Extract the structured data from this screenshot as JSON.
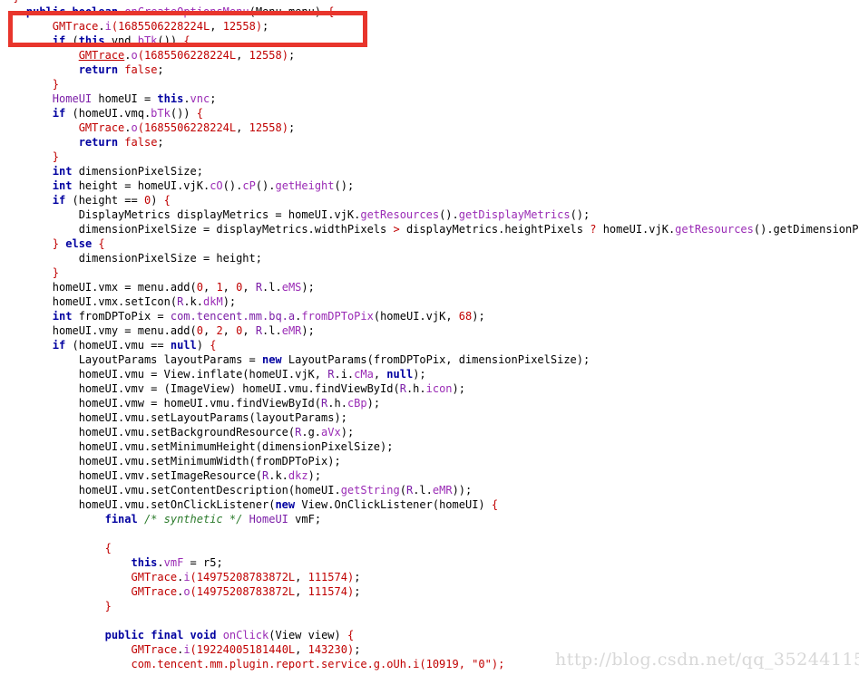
{
  "code_lines": [
    [
      {
        "t": "  }",
        "c": "p"
      }
    ],
    [
      {
        "t": "    "
      },
      {
        "t": "public",
        "c": "kw"
      },
      {
        "t": " "
      },
      {
        "t": "boolean",
        "c": "kw"
      },
      {
        "t": " "
      },
      {
        "t": "onCreateOptionsMenu",
        "c": "mt"
      },
      {
        "t": "(Menu menu) "
      },
      {
        "t": "{",
        "c": "p"
      }
    ],
    [
      {
        "t": "        "
      },
      {
        "t": "GMTrace",
        "c": "nm"
      },
      {
        "t": "."
      },
      {
        "t": "i",
        "c": "mt"
      },
      {
        "t": "(",
        "c": "p"
      },
      {
        "t": "1685506228224L",
        "c": "nm"
      },
      {
        "t": ", "
      },
      {
        "t": "12558",
        "c": "nm"
      },
      {
        "t": ")",
        "c": "p"
      },
      {
        "t": ";"
      }
    ],
    [
      {
        "t": "        "
      },
      {
        "t": "if",
        "c": "kw"
      },
      {
        "t": " ("
      },
      {
        "t": "this",
        "c": "kw"
      },
      {
        "t": ".vnd."
      },
      {
        "t": "bTk",
        "c": "mt"
      },
      {
        "t": "()) "
      },
      {
        "t": "{",
        "c": "p"
      }
    ],
    [
      {
        "t": "            "
      },
      {
        "t": "GMTrace",
        "c": "nm ul"
      },
      {
        "t": "."
      },
      {
        "t": "o",
        "c": "mt"
      },
      {
        "t": "(",
        "c": "p"
      },
      {
        "t": "1685506228224L",
        "c": "nm"
      },
      {
        "t": ", "
      },
      {
        "t": "12558",
        "c": "nm"
      },
      {
        "t": ")",
        "c": "p"
      },
      {
        "t": ";"
      }
    ],
    [
      {
        "t": "            "
      },
      {
        "t": "return",
        "c": "kw"
      },
      {
        "t": " "
      },
      {
        "t": "false",
        "c": "nm"
      },
      {
        "t": ";"
      }
    ],
    [
      {
        "t": "        "
      },
      {
        "t": "}",
        "c": "p"
      }
    ],
    [
      {
        "t": "        "
      },
      {
        "t": "HomeUI",
        "c": "ty"
      },
      {
        "t": " homeUI = "
      },
      {
        "t": "this",
        "c": "kw"
      },
      {
        "t": "."
      },
      {
        "t": "vnc",
        "c": "mt"
      },
      {
        "t": ";"
      }
    ],
    [
      {
        "t": "        "
      },
      {
        "t": "if",
        "c": "kw"
      },
      {
        "t": " (homeUI.vmq."
      },
      {
        "t": "bTk",
        "c": "mt"
      },
      {
        "t": "()) "
      },
      {
        "t": "{",
        "c": "p"
      }
    ],
    [
      {
        "t": "            "
      },
      {
        "t": "GMTrace",
        "c": "nm"
      },
      {
        "t": "."
      },
      {
        "t": "o",
        "c": "mt"
      },
      {
        "t": "(",
        "c": "p"
      },
      {
        "t": "1685506228224L",
        "c": "nm"
      },
      {
        "t": ", "
      },
      {
        "t": "12558",
        "c": "nm"
      },
      {
        "t": ")",
        "c": "p"
      },
      {
        "t": ";"
      }
    ],
    [
      {
        "t": "            "
      },
      {
        "t": "return",
        "c": "kw"
      },
      {
        "t": " "
      },
      {
        "t": "false",
        "c": "nm"
      },
      {
        "t": ";"
      }
    ],
    [
      {
        "t": "        "
      },
      {
        "t": "}",
        "c": "p"
      }
    ],
    [
      {
        "t": "        "
      },
      {
        "t": "int",
        "c": "kw"
      },
      {
        "t": " dimensionPixelSize;"
      }
    ],
    [
      {
        "t": "        "
      },
      {
        "t": "int",
        "c": "kw"
      },
      {
        "t": " height = homeUI.vjK."
      },
      {
        "t": "cO",
        "c": "mt"
      },
      {
        "t": "()."
      },
      {
        "t": "cP",
        "c": "mt"
      },
      {
        "t": "()."
      },
      {
        "t": "getHeight",
        "c": "mt"
      },
      {
        "t": "();"
      }
    ],
    [
      {
        "t": "        "
      },
      {
        "t": "if",
        "c": "kw"
      },
      {
        "t": " (height == "
      },
      {
        "t": "0",
        "c": "nm"
      },
      {
        "t": ") "
      },
      {
        "t": "{",
        "c": "p"
      }
    ],
    [
      {
        "t": "            DisplayMetrics displayMetrics = homeUI.vjK."
      },
      {
        "t": "getResources",
        "c": "mt"
      },
      {
        "t": "()."
      },
      {
        "t": "getDisplayMetrics",
        "c": "mt"
      },
      {
        "t": "();"
      }
    ],
    [
      {
        "t": "            dimensionPixelSize = displayMetrics.widthPixels "
      },
      {
        "t": ">",
        "c": "p"
      },
      {
        "t": " displayMetrics.heightPixels "
      },
      {
        "t": "?",
        "c": "p"
      },
      {
        "t": " homeUI.vjK."
      },
      {
        "t": "getResources",
        "c": "mt"
      },
      {
        "t": "().getDimensionPixelSize("
      }
    ],
    [
      {
        "t": "        "
      },
      {
        "t": "}",
        "c": "p"
      },
      {
        "t": " "
      },
      {
        "t": "else",
        "c": "kw"
      },
      {
        "t": " "
      },
      {
        "t": "{",
        "c": "p"
      }
    ],
    [
      {
        "t": "            dimensionPixelSize = height;"
      }
    ],
    [
      {
        "t": "        "
      },
      {
        "t": "}",
        "c": "p"
      }
    ],
    [
      {
        "t": "        homeUI.vmx = menu.add("
      },
      {
        "t": "0",
        "c": "nm"
      },
      {
        "t": ", "
      },
      {
        "t": "1",
        "c": "nm"
      },
      {
        "t": ", "
      },
      {
        "t": "0",
        "c": "nm"
      },
      {
        "t": ", "
      },
      {
        "t": "R",
        "c": "ty"
      },
      {
        "t": ".l."
      },
      {
        "t": "eMS",
        "c": "mt"
      },
      {
        "t": ");"
      }
    ],
    [
      {
        "t": "        homeUI.vmx.setIcon("
      },
      {
        "t": "R",
        "c": "ty"
      },
      {
        "t": ".k."
      },
      {
        "t": "dkM",
        "c": "mt"
      },
      {
        "t": ");"
      }
    ],
    [
      {
        "t": "        "
      },
      {
        "t": "int",
        "c": "kw"
      },
      {
        "t": " fromDPToPix = "
      },
      {
        "t": "com.tencent.mm.bq.a",
        "c": "ty"
      },
      {
        "t": "."
      },
      {
        "t": "fromDPToPix",
        "c": "mt"
      },
      {
        "t": "(homeUI.vjK, "
      },
      {
        "t": "68",
        "c": "nm"
      },
      {
        "t": ");"
      }
    ],
    [
      {
        "t": "        homeUI.vmy = menu.add("
      },
      {
        "t": "0",
        "c": "nm"
      },
      {
        "t": ", "
      },
      {
        "t": "2",
        "c": "nm"
      },
      {
        "t": ", "
      },
      {
        "t": "0",
        "c": "nm"
      },
      {
        "t": ", "
      },
      {
        "t": "R",
        "c": "ty"
      },
      {
        "t": ".l."
      },
      {
        "t": "eMR",
        "c": "mt"
      },
      {
        "t": ");"
      }
    ],
    [
      {
        "t": "        "
      },
      {
        "t": "if",
        "c": "kw"
      },
      {
        "t": " (homeUI.vmu == "
      },
      {
        "t": "null",
        "c": "kw"
      },
      {
        "t": ") "
      },
      {
        "t": "{",
        "c": "p"
      }
    ],
    [
      {
        "t": "            LayoutParams layoutParams = "
      },
      {
        "t": "new",
        "c": "kw"
      },
      {
        "t": " LayoutParams(fromDPToPix, dimensionPixelSize);"
      }
    ],
    [
      {
        "t": "            homeUI.vmu = View.inflate(homeUI.vjK, "
      },
      {
        "t": "R",
        "c": "ty"
      },
      {
        "t": ".i."
      },
      {
        "t": "cMa",
        "c": "mt"
      },
      {
        "t": ", "
      },
      {
        "t": "null",
        "c": "kw"
      },
      {
        "t": ");"
      }
    ],
    [
      {
        "t": "            homeUI.vmv = (ImageView) homeUI.vmu.findViewById("
      },
      {
        "t": "R",
        "c": "ty"
      },
      {
        "t": ".h."
      },
      {
        "t": "icon",
        "c": "mt"
      },
      {
        "t": ");"
      }
    ],
    [
      {
        "t": "            homeUI.vmw = homeUI.vmu.findViewById("
      },
      {
        "t": "R",
        "c": "ty"
      },
      {
        "t": ".h."
      },
      {
        "t": "cBp",
        "c": "mt"
      },
      {
        "t": ");"
      }
    ],
    [
      {
        "t": "            homeUI.vmu.setLayoutParams(layoutParams);"
      }
    ],
    [
      {
        "t": "            homeUI.vmu.setBackgroundResource("
      },
      {
        "t": "R",
        "c": "ty"
      },
      {
        "t": ".g."
      },
      {
        "t": "aVx",
        "c": "mt"
      },
      {
        "t": ");"
      }
    ],
    [
      {
        "t": "            homeUI.vmu.setMinimumHeight(dimensionPixelSize);"
      }
    ],
    [
      {
        "t": "            homeUI.vmu.setMinimumWidth(fromDPToPix);"
      }
    ],
    [
      {
        "t": "            homeUI.vmv.setImageResource("
      },
      {
        "t": "R",
        "c": "ty"
      },
      {
        "t": ".k."
      },
      {
        "t": "dkz",
        "c": "mt"
      },
      {
        "t": ");"
      }
    ],
    [
      {
        "t": "            homeUI.vmu.setContentDescription(homeUI."
      },
      {
        "t": "getString",
        "c": "mt"
      },
      {
        "t": "("
      },
      {
        "t": "R",
        "c": "ty"
      },
      {
        "t": ".l."
      },
      {
        "t": "eMR",
        "c": "mt"
      },
      {
        "t": "));"
      }
    ],
    [
      {
        "t": "            homeUI.vmu.setOnClickListener("
      },
      {
        "t": "new",
        "c": "kw"
      },
      {
        "t": " View.OnClickListener(homeUI) "
      },
      {
        "t": "{",
        "c": "p"
      }
    ],
    [
      {
        "t": "                "
      },
      {
        "t": "final",
        "c": "kw"
      },
      {
        "t": " "
      },
      {
        "t": "/* synthetic */",
        "c": "cm"
      },
      {
        "t": " "
      },
      {
        "t": "HomeUI",
        "c": "ty"
      },
      {
        "t": " vmF;"
      }
    ],
    [
      {
        "t": ""
      }
    ],
    [
      {
        "t": "                "
      },
      {
        "t": "{",
        "c": "p"
      }
    ],
    [
      {
        "t": "                    "
      },
      {
        "t": "this",
        "c": "kw"
      },
      {
        "t": "."
      },
      {
        "t": "vmF",
        "c": "mt"
      },
      {
        "t": " = r5;"
      }
    ],
    [
      {
        "t": "                    "
      },
      {
        "t": "GMTrace",
        "c": "nm"
      },
      {
        "t": "."
      },
      {
        "t": "i",
        "c": "mt"
      },
      {
        "t": "(",
        "c": "p"
      },
      {
        "t": "14975208783872L",
        "c": "nm"
      },
      {
        "t": ", "
      },
      {
        "t": "111574",
        "c": "nm"
      },
      {
        "t": ")",
        "c": "p"
      },
      {
        "t": ";"
      }
    ],
    [
      {
        "t": "                    "
      },
      {
        "t": "GMTrace",
        "c": "nm"
      },
      {
        "t": "."
      },
      {
        "t": "o",
        "c": "mt"
      },
      {
        "t": "(",
        "c": "p"
      },
      {
        "t": "14975208783872L",
        "c": "nm"
      },
      {
        "t": ", "
      },
      {
        "t": "111574",
        "c": "nm"
      },
      {
        "t": ")",
        "c": "p"
      },
      {
        "t": ";"
      }
    ],
    [
      {
        "t": "                "
      },
      {
        "t": "}",
        "c": "p"
      }
    ],
    [
      {
        "t": ""
      }
    ],
    [
      {
        "t": "                "
      },
      {
        "t": "public",
        "c": "kw"
      },
      {
        "t": " "
      },
      {
        "t": "final",
        "c": "kw"
      },
      {
        "t": " "
      },
      {
        "t": "void",
        "c": "kw"
      },
      {
        "t": " "
      },
      {
        "t": "onClick",
        "c": "mt"
      },
      {
        "t": "(View view) "
      },
      {
        "t": "{",
        "c": "p"
      }
    ],
    [
      {
        "t": "                    "
      },
      {
        "t": "GMTrace",
        "c": "nm"
      },
      {
        "t": "."
      },
      {
        "t": "i",
        "c": "mt"
      },
      {
        "t": "(",
        "c": "p"
      },
      {
        "t": "19224005181440L",
        "c": "nm"
      },
      {
        "t": ", "
      },
      {
        "t": "143230",
        "c": "nm"
      },
      {
        "t": ")",
        "c": "p"
      },
      {
        "t": ";"
      }
    ],
    [
      {
        "t": "                    "
      },
      {
        "t": "com.tencent.mm.plugin.report.service.g.oUh.i(10919, \"0\");",
        "c": "dm"
      }
    ]
  ],
  "watermark": "http://blog.csdn.net/qq_35244115",
  "highlight_color": "#e8352c",
  "colors": {
    "keyword": "#0000a0",
    "method": "#9a2bb5",
    "number": "#c00000",
    "comment": "#2a7a2a"
  }
}
